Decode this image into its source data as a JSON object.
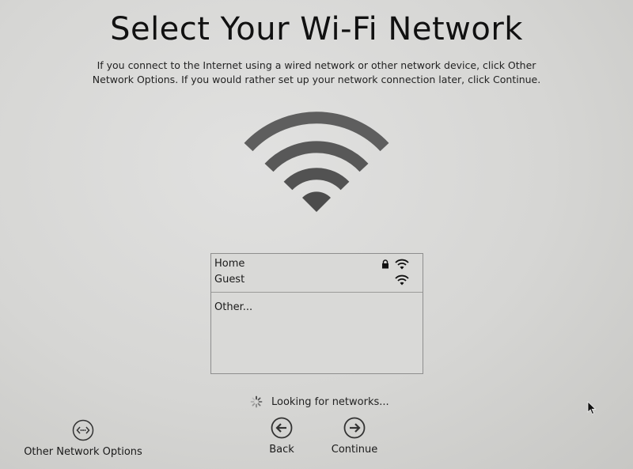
{
  "header": {
    "title": "Select Your Wi-Fi Network",
    "subtitle_line1": "If you connect to the Internet using a wired network or other network device, click Other",
    "subtitle_line2": "Network Options. If you would rather set up your network connection later, click Continue."
  },
  "logo": {
    "icon": "wifi-icon"
  },
  "networks": {
    "items": [
      {
        "name": "Home",
        "secured": true,
        "icon": "wifi-signal-icon"
      },
      {
        "name": "Guest",
        "secured": false,
        "icon": "wifi-signal-icon"
      }
    ],
    "other_label": "Other..."
  },
  "status": {
    "text": "Looking for networks...",
    "icon": "spinner-icon"
  },
  "buttons": {
    "other_options_label": "Other Network Options",
    "back_label": "Back",
    "continue_label": "Continue"
  },
  "colors": {
    "background": "#d6d6d4",
    "wifi_logo": "#5a5a5a",
    "text": "#1a1a1a"
  }
}
